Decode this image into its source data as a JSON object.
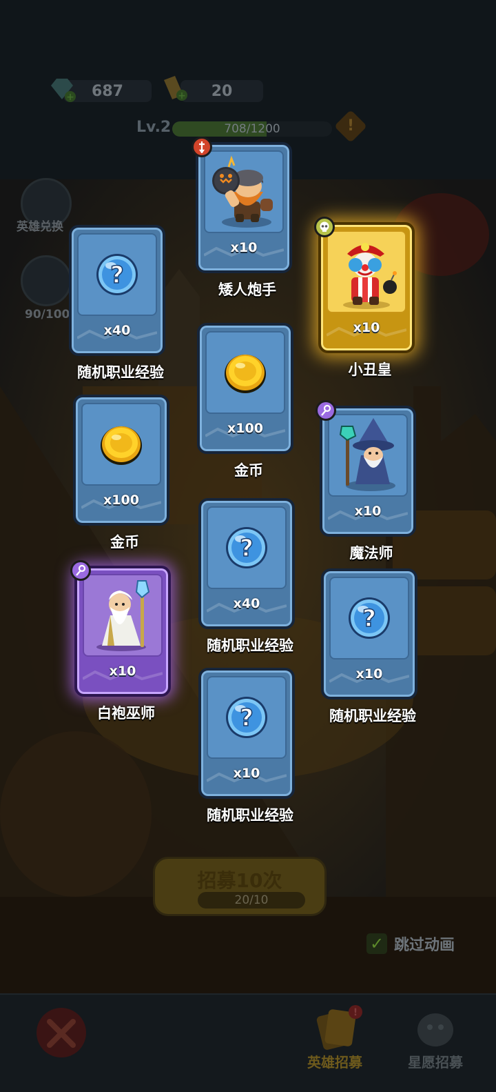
{
  "currency": {
    "gems": "687",
    "tickets": "20"
  },
  "level": {
    "label": "Lv.2",
    "xp": "708/1200",
    "xp_fraction": 0.59
  },
  "side": {
    "hero_exchange": "英雄兑换",
    "star_progress": "90/100"
  },
  "recruit": {
    "label": "招募10次",
    "cost": "20/10"
  },
  "skip_animation": {
    "label": "跳过动画",
    "checked": true
  },
  "nav": {
    "hero_recruit": "英雄招募",
    "wish_recruit": "星愿招募"
  },
  "rewards": [
    {
      "name": "矮人炮手",
      "qty": "x10",
      "icon": "dwarf-gunner",
      "rarity": "blue",
      "badge": "warrior"
    },
    {
      "name": "小丑皇",
      "qty": "x10",
      "icon": "clown-king",
      "rarity": "gold",
      "badge": "skull"
    },
    {
      "name": "随机职业经验",
      "qty": "x40",
      "icon": "question-orb",
      "rarity": "blue"
    },
    {
      "name": "金币",
      "qty": "x100",
      "icon": "gold-coin",
      "rarity": "blue"
    },
    {
      "name": "金币",
      "qty": "x100",
      "icon": "gold-coin",
      "rarity": "blue"
    },
    {
      "name": "魔法师",
      "qty": "x10",
      "icon": "wizard",
      "rarity": "blue",
      "badge": "mage"
    },
    {
      "name": "随机职业经验",
      "qty": "x40",
      "icon": "question-orb",
      "rarity": "blue"
    },
    {
      "name": "白袍巫师",
      "qty": "x10",
      "icon": "white-wizard",
      "rarity": "purple",
      "badge": "mage"
    },
    {
      "name": "随机职业经验",
      "qty": "x10",
      "icon": "question-orb",
      "rarity": "blue"
    },
    {
      "name": "随机职业经验",
      "qty": "x10",
      "icon": "question-orb",
      "rarity": "blue"
    }
  ]
}
